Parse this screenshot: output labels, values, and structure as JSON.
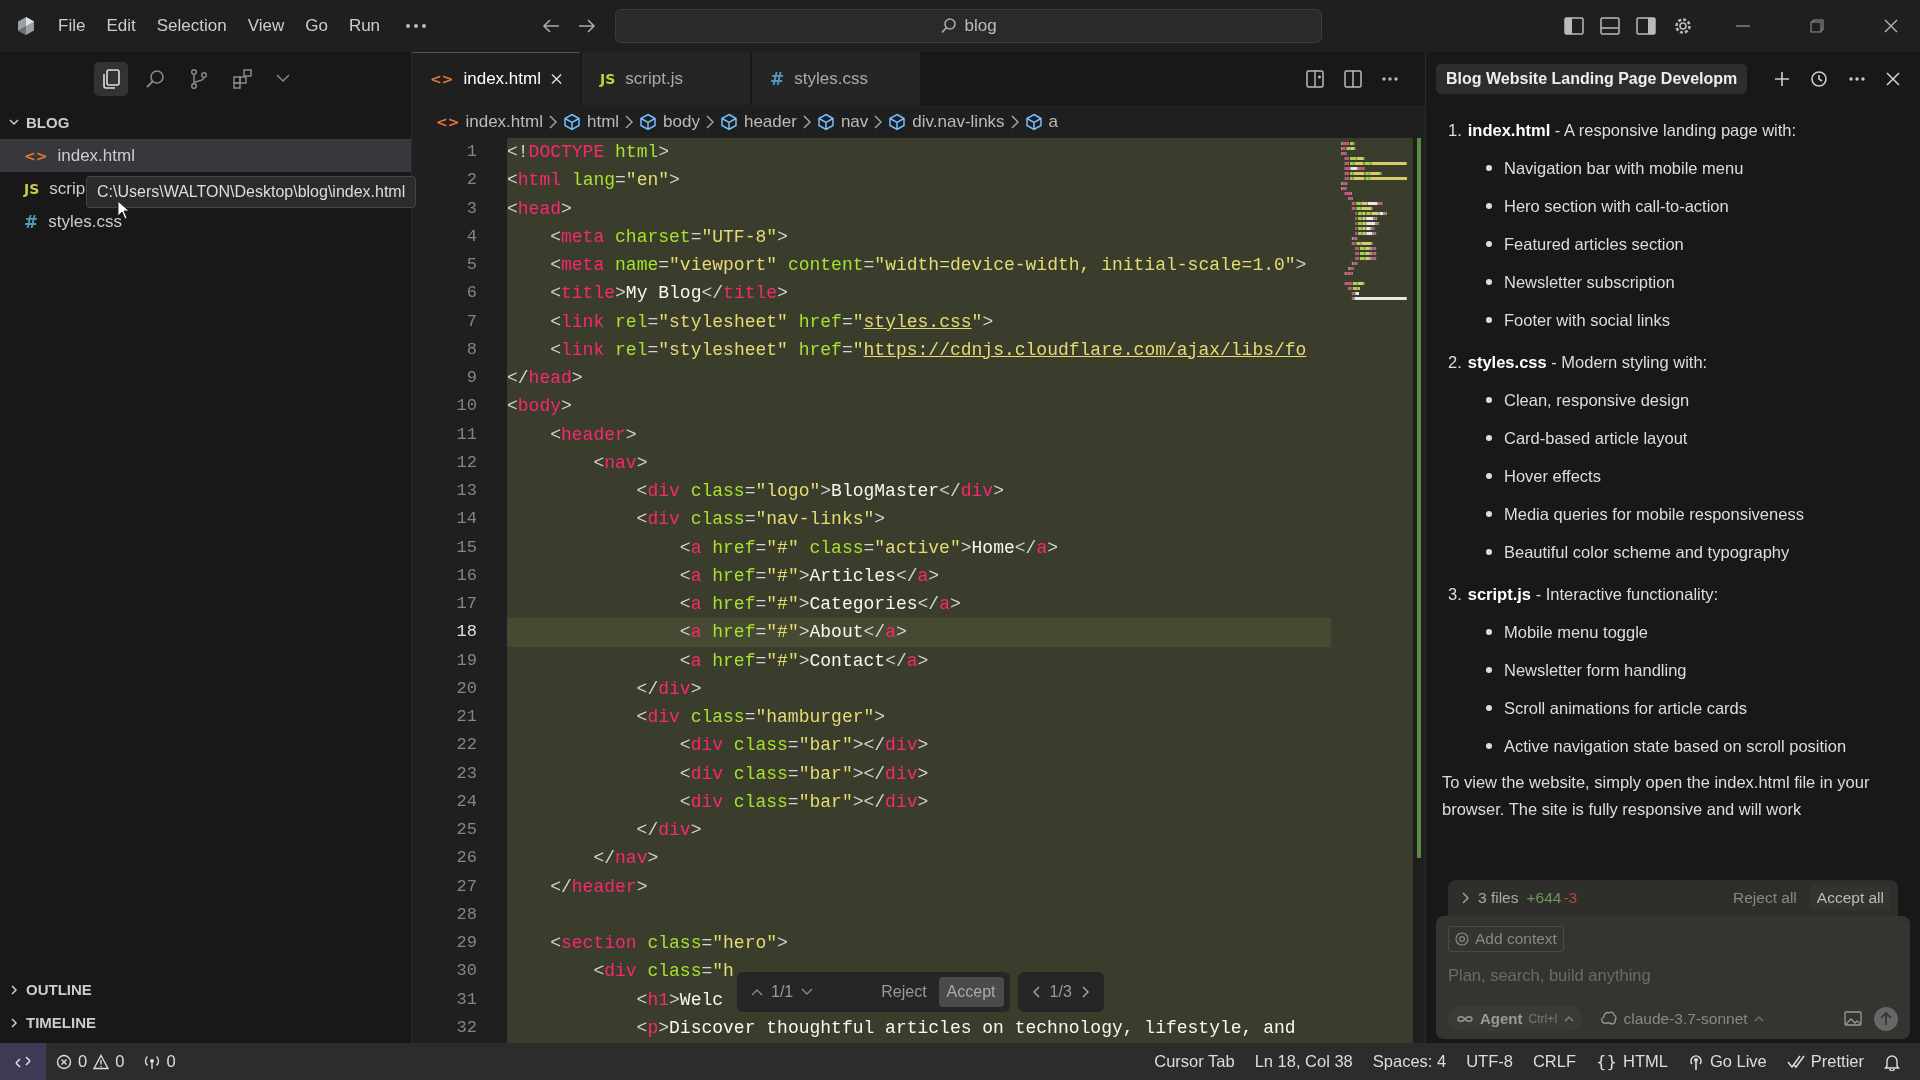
{
  "titlebar": {
    "menu": [
      "File",
      "Edit",
      "Selection",
      "View",
      "Go",
      "Run"
    ],
    "search": {
      "value": "blog"
    }
  },
  "sidebar": {
    "actions": [
      {
        "kind": "files",
        "selected": true
      },
      {
        "kind": "search",
        "selected": false
      },
      {
        "kind": "source-control",
        "selected": false
      },
      {
        "kind": "extensions",
        "selected": false
      }
    ],
    "root": {
      "label": "BLOG",
      "expanded": true
    },
    "files": [
      {
        "name": "index.html",
        "icon": "<>",
        "kind": "html",
        "selected": true
      },
      {
        "name": "scrip",
        "icon": "JS",
        "kind": "js",
        "selected": false
      },
      {
        "name": "styles.css",
        "icon": "#",
        "kind": "css",
        "selected": false
      }
    ],
    "tooltip": "C:\\Users\\WALTON\\Desktop\\blog\\index.html",
    "sections": [
      {
        "label": "OUTLINE",
        "expanded": false
      },
      {
        "label": "TIMELINE",
        "expanded": false
      }
    ]
  },
  "editor": {
    "tabs": [
      {
        "name": "index.html",
        "icon": "<>",
        "kind": "html",
        "selected": true
      },
      {
        "name": "script.js",
        "icon": "JS",
        "kind": "js",
        "selected": false
      },
      {
        "name": "styles.css",
        "icon": "#",
        "kind": "css",
        "selected": false
      }
    ],
    "breadcrumb": [
      {
        "label": "index.html",
        "kind": "file",
        "icon": "<>"
      },
      {
        "label": "html",
        "kind": "symbol"
      },
      {
        "label": "body",
        "kind": "symbol"
      },
      {
        "label": "header",
        "kind": "symbol"
      },
      {
        "label": "nav",
        "kind": "symbol"
      },
      {
        "label": "div.nav-links",
        "kind": "symbol"
      },
      {
        "label": "a",
        "kind": "symbol"
      }
    ],
    "lines": [
      {
        "n": "1",
        "current": false,
        "tokens": [
          {
            "kind": "p",
            "text": "<!"
          },
          {
            "kind": "t",
            "text": "DOCTYPE"
          },
          {
            "kind": "a",
            "text": " html"
          },
          {
            "kind": "p",
            "text": ">"
          }
        ]
      },
      {
        "n": "2",
        "current": false,
        "tokens": [
          {
            "kind": "p",
            "text": "<"
          },
          {
            "kind": "t",
            "text": "html"
          },
          {
            "kind": "a",
            "text": " lang"
          },
          {
            "kind": "p",
            "text": "="
          },
          {
            "kind": "s",
            "text": "\"en\""
          },
          {
            "kind": "p",
            "text": ">"
          }
        ]
      },
      {
        "n": "3",
        "current": false,
        "tokens": [
          {
            "kind": "p",
            "text": "<"
          },
          {
            "kind": "t",
            "text": "head"
          },
          {
            "kind": "p",
            "text": ">"
          }
        ]
      },
      {
        "n": "4",
        "current": false,
        "tokens": [
          {
            "kind": "p",
            "text": "    <"
          },
          {
            "kind": "t",
            "text": "meta"
          },
          {
            "kind": "a",
            "text": " charset"
          },
          {
            "kind": "p",
            "text": "="
          },
          {
            "kind": "s",
            "text": "\"UTF-8\""
          },
          {
            "kind": "p",
            "text": ">"
          }
        ]
      },
      {
        "n": "5",
        "current": false,
        "tokens": [
          {
            "kind": "p",
            "text": "    <"
          },
          {
            "kind": "t",
            "text": "meta"
          },
          {
            "kind": "a",
            "text": " name"
          },
          {
            "kind": "p",
            "text": "="
          },
          {
            "kind": "s",
            "text": "\"viewport\""
          },
          {
            "kind": "a",
            "text": " content"
          },
          {
            "kind": "p",
            "text": "="
          },
          {
            "kind": "s",
            "text": "\"width=device-width, initial-scale=1.0\""
          },
          {
            "kind": "p",
            "text": ">"
          }
        ]
      },
      {
        "n": "6",
        "current": false,
        "tokens": [
          {
            "kind": "p",
            "text": "    <"
          },
          {
            "kind": "t",
            "text": "title"
          },
          {
            "kind": "p",
            "text": ">"
          },
          {
            "kind": "x",
            "text": "My Blog"
          },
          {
            "kind": "p",
            "text": "</"
          },
          {
            "kind": "t",
            "text": "title"
          },
          {
            "kind": "p",
            "text": ">"
          }
        ]
      },
      {
        "n": "7",
        "current": false,
        "tokens": [
          {
            "kind": "p",
            "text": "    <"
          },
          {
            "kind": "t",
            "text": "link"
          },
          {
            "kind": "a",
            "text": " rel"
          },
          {
            "kind": "p",
            "text": "="
          },
          {
            "kind": "s",
            "text": "\"stylesheet\""
          },
          {
            "kind": "a",
            "text": " href"
          },
          {
            "kind": "p",
            "text": "="
          },
          {
            "kind": "s",
            "text": "\""
          },
          {
            "kind": "l",
            "text": "styles.css"
          },
          {
            "kind": "s",
            "text": "\""
          },
          {
            "kind": "p",
            "text": ">"
          }
        ]
      },
      {
        "n": "8",
        "current": false,
        "tokens": [
          {
            "kind": "p",
            "text": "    <"
          },
          {
            "kind": "t",
            "text": "link"
          },
          {
            "kind": "a",
            "text": " rel"
          },
          {
            "kind": "p",
            "text": "="
          },
          {
            "kind": "s",
            "text": "\"stylesheet\""
          },
          {
            "kind": "a",
            "text": " href"
          },
          {
            "kind": "p",
            "text": "="
          },
          {
            "kind": "s",
            "text": "\""
          },
          {
            "kind": "l",
            "text": "https://cdnjs.cloudflare.com/ajax/libs/fo"
          }
        ]
      },
      {
        "n": "9",
        "current": false,
        "tokens": [
          {
            "kind": "p",
            "text": "</"
          },
          {
            "kind": "t",
            "text": "head"
          },
          {
            "kind": "p",
            "text": ">"
          }
        ]
      },
      {
        "n": "10",
        "current": false,
        "tokens": [
          {
            "kind": "p",
            "text": "<"
          },
          {
            "kind": "t",
            "text": "body"
          },
          {
            "kind": "p",
            "text": ">"
          }
        ]
      },
      {
        "n": "11",
        "current": false,
        "tokens": [
          {
            "kind": "p",
            "text": "    <"
          },
          {
            "kind": "t",
            "text": "header"
          },
          {
            "kind": "p",
            "text": ">"
          }
        ]
      },
      {
        "n": "12",
        "current": false,
        "tokens": [
          {
            "kind": "p",
            "text": "        <"
          },
          {
            "kind": "t",
            "text": "nav"
          },
          {
            "kind": "p",
            "text": ">"
          }
        ]
      },
      {
        "n": "13",
        "current": false,
        "tokens": [
          {
            "kind": "p",
            "text": "            <"
          },
          {
            "kind": "t",
            "text": "div"
          },
          {
            "kind": "a",
            "text": " class"
          },
          {
            "kind": "p",
            "text": "="
          },
          {
            "kind": "s",
            "text": "\"logo\""
          },
          {
            "kind": "p",
            "text": ">"
          },
          {
            "kind": "x",
            "text": "BlogMaster"
          },
          {
            "kind": "p",
            "text": "</"
          },
          {
            "kind": "t",
            "text": "div"
          },
          {
            "kind": "p",
            "text": ">"
          }
        ]
      },
      {
        "n": "14",
        "current": false,
        "tokens": [
          {
            "kind": "p",
            "text": "            <"
          },
          {
            "kind": "t",
            "text": "div"
          },
          {
            "kind": "a",
            "text": " class"
          },
          {
            "kind": "p",
            "text": "="
          },
          {
            "kind": "s",
            "text": "\"nav-links\""
          },
          {
            "kind": "p",
            "text": ">"
          }
        ]
      },
      {
        "n": "15",
        "current": false,
        "tokens": [
          {
            "kind": "p",
            "text": "                <"
          },
          {
            "kind": "t",
            "text": "a"
          },
          {
            "kind": "a",
            "text": " href"
          },
          {
            "kind": "p",
            "text": "="
          },
          {
            "kind": "s",
            "text": "\"#\""
          },
          {
            "kind": "a",
            "text": " class"
          },
          {
            "kind": "p",
            "text": "="
          },
          {
            "kind": "s",
            "text": "\"active\""
          },
          {
            "kind": "p",
            "text": ">"
          },
          {
            "kind": "x",
            "text": "Home"
          },
          {
            "kind": "p",
            "text": "</"
          },
          {
            "kind": "t",
            "text": "a"
          },
          {
            "kind": "p",
            "text": ">"
          }
        ]
      },
      {
        "n": "16",
        "current": false,
        "tokens": [
          {
            "kind": "p",
            "text": "                <"
          },
          {
            "kind": "t",
            "text": "a"
          },
          {
            "kind": "a",
            "text": " href"
          },
          {
            "kind": "p",
            "text": "="
          },
          {
            "kind": "s",
            "text": "\"#\""
          },
          {
            "kind": "p",
            "text": ">"
          },
          {
            "kind": "x",
            "text": "Articles"
          },
          {
            "kind": "p",
            "text": "</"
          },
          {
            "kind": "t",
            "text": "a"
          },
          {
            "kind": "p",
            "text": ">"
          }
        ]
      },
      {
        "n": "17",
        "current": false,
        "tokens": [
          {
            "kind": "p",
            "text": "                <"
          },
          {
            "kind": "t",
            "text": "a"
          },
          {
            "kind": "a",
            "text": " href"
          },
          {
            "kind": "p",
            "text": "="
          },
          {
            "kind": "s",
            "text": "\"#\""
          },
          {
            "kind": "p",
            "text": ">"
          },
          {
            "kind": "x",
            "text": "Categories"
          },
          {
            "kind": "p",
            "text": "</"
          },
          {
            "kind": "t",
            "text": "a"
          },
          {
            "kind": "p",
            "text": ">"
          }
        ]
      },
      {
        "n": "18",
        "current": true,
        "tokens": [
          {
            "kind": "p",
            "text": "                <"
          },
          {
            "kind": "t",
            "text": "a"
          },
          {
            "kind": "a",
            "text": " href"
          },
          {
            "kind": "p",
            "text": "="
          },
          {
            "kind": "s",
            "text": "\"#\""
          },
          {
            "kind": "p",
            "text": ">"
          },
          {
            "kind": "x",
            "text": "About"
          },
          {
            "kind": "p",
            "text": "</"
          },
          {
            "kind": "t",
            "text": "a"
          },
          {
            "kind": "p",
            "text": ">"
          }
        ]
      },
      {
        "n": "19",
        "current": false,
        "tokens": [
          {
            "kind": "p",
            "text": "                <"
          },
          {
            "kind": "t",
            "text": "a"
          },
          {
            "kind": "a",
            "text": " href"
          },
          {
            "kind": "p",
            "text": "="
          },
          {
            "kind": "s",
            "text": "\"#\""
          },
          {
            "kind": "p",
            "text": ">"
          },
          {
            "kind": "x",
            "text": "Contact"
          },
          {
            "kind": "p",
            "text": "</"
          },
          {
            "kind": "t",
            "text": "a"
          },
          {
            "kind": "p",
            "text": ">"
          }
        ]
      },
      {
        "n": "20",
        "current": false,
        "tokens": [
          {
            "kind": "p",
            "text": "            </"
          },
          {
            "kind": "t",
            "text": "div"
          },
          {
            "kind": "p",
            "text": ">"
          }
        ]
      },
      {
        "n": "21",
        "current": false,
        "tokens": [
          {
            "kind": "p",
            "text": "            <"
          },
          {
            "kind": "t",
            "text": "div"
          },
          {
            "kind": "a",
            "text": " class"
          },
          {
            "kind": "p",
            "text": "="
          },
          {
            "kind": "s",
            "text": "\"hamburger\""
          },
          {
            "kind": "p",
            "text": ">"
          }
        ]
      },
      {
        "n": "22",
        "current": false,
        "tokens": [
          {
            "kind": "p",
            "text": "                <"
          },
          {
            "kind": "t",
            "text": "div"
          },
          {
            "kind": "a",
            "text": " class"
          },
          {
            "kind": "p",
            "text": "="
          },
          {
            "kind": "s",
            "text": "\"bar\""
          },
          {
            "kind": "p",
            "text": "></"
          },
          {
            "kind": "t",
            "text": "div"
          },
          {
            "kind": "p",
            "text": ">"
          }
        ]
      },
      {
        "n": "23",
        "current": false,
        "tokens": [
          {
            "kind": "p",
            "text": "                <"
          },
          {
            "kind": "t",
            "text": "div"
          },
          {
            "kind": "a",
            "text": " class"
          },
          {
            "kind": "p",
            "text": "="
          },
          {
            "kind": "s",
            "text": "\"bar\""
          },
          {
            "kind": "p",
            "text": "></"
          },
          {
            "kind": "t",
            "text": "div"
          },
          {
            "kind": "p",
            "text": ">"
          }
        ]
      },
      {
        "n": "24",
        "current": false,
        "tokens": [
          {
            "kind": "p",
            "text": "                <"
          },
          {
            "kind": "t",
            "text": "div"
          },
          {
            "kind": "a",
            "text": " class"
          },
          {
            "kind": "p",
            "text": "="
          },
          {
            "kind": "s",
            "text": "\"bar\""
          },
          {
            "kind": "p",
            "text": "></"
          },
          {
            "kind": "t",
            "text": "div"
          },
          {
            "kind": "p",
            "text": ">"
          }
        ]
      },
      {
        "n": "25",
        "current": false,
        "tokens": [
          {
            "kind": "p",
            "text": "            </"
          },
          {
            "kind": "t",
            "text": "div"
          },
          {
            "kind": "p",
            "text": ">"
          }
        ]
      },
      {
        "n": "26",
        "current": false,
        "tokens": [
          {
            "kind": "p",
            "text": "        </"
          },
          {
            "kind": "t",
            "text": "nav"
          },
          {
            "kind": "p",
            "text": ">"
          }
        ]
      },
      {
        "n": "27",
        "current": false,
        "tokens": [
          {
            "kind": "p",
            "text": "    </"
          },
          {
            "kind": "t",
            "text": "header"
          },
          {
            "kind": "p",
            "text": ">"
          }
        ]
      },
      {
        "n": "28",
        "current": false
      },
      {
        "n": "29",
        "current": false,
        "tokens": [
          {
            "kind": "p",
            "text": "    <"
          },
          {
            "kind": "t",
            "text": "section"
          },
          {
            "kind": "a",
            "text": " class"
          },
          {
            "kind": "p",
            "text": "="
          },
          {
            "kind": "s",
            "text": "\"hero\""
          },
          {
            "kind": "p",
            "text": ">"
          }
        ]
      },
      {
        "n": "30",
        "current": false,
        "tokens": [
          {
            "kind": "p",
            "text": "        <"
          },
          {
            "kind": "t",
            "text": "div"
          },
          {
            "kind": "a",
            "text": " class"
          },
          {
            "kind": "p",
            "text": "="
          },
          {
            "kind": "s",
            "text": "\"h"
          }
        ]
      },
      {
        "n": "31",
        "current": false,
        "tokens": [
          {
            "kind": "p",
            "text": "            <"
          },
          {
            "kind": "t",
            "text": "h1"
          },
          {
            "kind": "p",
            "text": ">"
          },
          {
            "kind": "x",
            "text": "Welc"
          }
        ]
      },
      {
        "n": "32",
        "current": false,
        "tokens": [
          {
            "kind": "p",
            "text": "            <"
          },
          {
            "kind": "t",
            "text": "p"
          },
          {
            "kind": "p",
            "text": ">"
          },
          {
            "kind": "x",
            "text": "Discover thoughtful articles on technology, lifestyle, and"
          }
        ]
      }
    ],
    "diff_widget": {
      "hunk": "1/1",
      "reject": "Reject",
      "accept": "Accept",
      "file": "1/3"
    }
  },
  "chat": {
    "title": "Blog Website Landing Page Developm",
    "items": [
      {
        "number": "1.",
        "text": "**index.html** - A responsive landing page with:",
        "bullets": [
          "Navigation bar with mobile menu",
          "Hero section with call-to-action",
          "Featured articles section",
          "Newsletter subscription",
          "Footer with social links"
        ]
      },
      {
        "number": "2.",
        "text": "**styles.css** - Modern styling with:",
        "bullets": [
          "Clean, responsive design",
          "Card-based article layout",
          "Hover effects",
          "Media queries for mobile responsiveness",
          "Beautiful color scheme and typography"
        ]
      },
      {
        "number": "3.",
        "text": "**script.js** - Interactive functionality:",
        "bullets": [
          "Mobile menu toggle",
          "Newsletter form handling",
          "Scroll animations for article cards",
          "Active navigation state based on scroll position"
        ]
      }
    ],
    "paragraph": "To view the website, simply open the index.html file in your browser. The site is fully responsive and will work",
    "composer": {
      "files": "3 files",
      "added": "+644",
      "removed": "-3",
      "reject": "Reject all",
      "accept": "Accept all",
      "context": "Add context",
      "placeholder": "Plan, search, build anything",
      "mode": "Agent",
      "shortcut": "Ctrl+I",
      "model": "claude-3.7-sonnet"
    }
  },
  "status_bar": {
    "errors": "0",
    "warnings": "0",
    "ports": "0",
    "right": [
      {
        "kind": "plain",
        "text": "Cursor Tab"
      },
      {
        "kind": "plain",
        "text": "Ln 18, Col 38"
      },
      {
        "kind": "plain",
        "text": "Spaces: 4"
      },
      {
        "kind": "plain",
        "text": "UTF-8"
      },
      {
        "kind": "plain",
        "text": "CRLF"
      },
      {
        "kind": "glyph",
        "glyph": "{}",
        "text": "HTML"
      },
      {
        "kind": "live",
        "text": "Go Live"
      },
      {
        "kind": "prettier",
        "text": "Prettier"
      },
      {
        "kind": "bell"
      }
    ]
  }
}
